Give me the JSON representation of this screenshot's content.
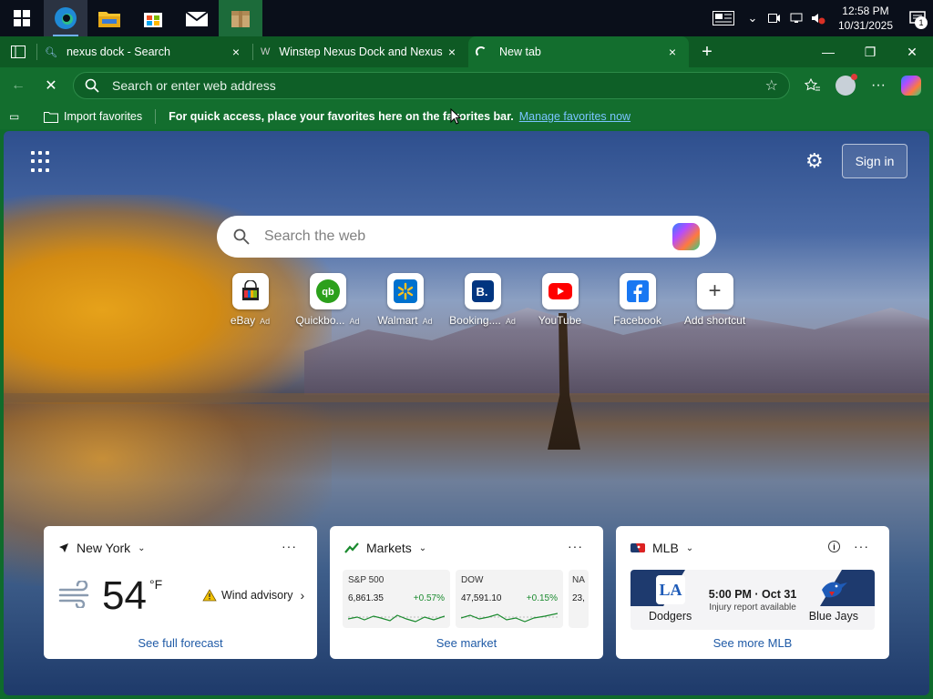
{
  "taskbar": {
    "apps": [
      "windows-start",
      "edge",
      "file-explorer",
      "microsoft-store",
      "mail",
      "package-app"
    ],
    "clock": {
      "time": "12:58 PM",
      "date": "10/31/2025"
    },
    "notifications_count": "1"
  },
  "tabs": [
    {
      "title": "nexus dock - Search",
      "close": "×"
    },
    {
      "title": "Winstep Nexus Dock and Nexus Ult",
      "close": "×"
    },
    {
      "title": "New tab",
      "close": "×"
    }
  ],
  "window_controls": {
    "new_tab": "+",
    "minimize": "—",
    "restore": "❐",
    "close": "✕"
  },
  "address_bar": {
    "placeholder": "Search or enter web address"
  },
  "favorites_bar": {
    "import_label": "Import favorites",
    "message": "For quick access, place your favorites here on the favorites bar.",
    "manage_link": "Manage favorites now"
  },
  "newtab": {
    "sign_in": "Sign in",
    "search_placeholder": "Search the web",
    "shortcuts": [
      {
        "label": "eBay",
        "ad": "Ad",
        "color": "#e53238"
      },
      {
        "label": "Quickbo...",
        "ad": "Ad",
        "color": "#2ca01c"
      },
      {
        "label": "Walmart",
        "ad": "Ad",
        "color": "#0071ce"
      },
      {
        "label": "Booking....",
        "ad": "Ad",
        "color": "#003580"
      },
      {
        "label": "YouTube",
        "ad": "",
        "color": "#ff0000"
      },
      {
        "label": "Facebook",
        "ad": "",
        "color": "#1877f2"
      },
      {
        "label": "Add shortcut",
        "ad": "",
        "color": "#444444"
      }
    ]
  },
  "weather": {
    "location": "New York",
    "temp": "54",
    "unit": "°F",
    "alert": "Wind advisory",
    "footer": "See full forecast"
  },
  "markets": {
    "title": "Markets",
    "tickers": [
      {
        "name": "S&P 500",
        "value": "6,861.35",
        "change": "+0.57%"
      },
      {
        "name": "DOW",
        "value": "47,591.10",
        "change": "+0.15%"
      },
      {
        "name": "NA",
        "value": "23,",
        "change": ""
      }
    ],
    "footer": "See market"
  },
  "mlb": {
    "title": "MLB",
    "time": "5:00 PM · Oct 31",
    "note": "Injury report available",
    "home": "Dodgers",
    "away": "Blue Jays",
    "footer": "See more MLB"
  }
}
